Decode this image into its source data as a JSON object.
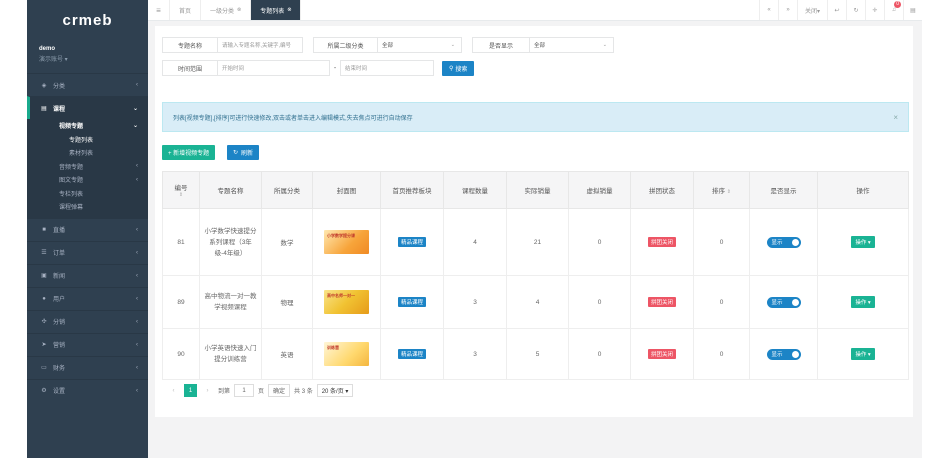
{
  "brand": "crmeb",
  "user": {
    "name": "demo",
    "role": "演示账号 ▾"
  },
  "sidebar": {
    "items_top": [
      {
        "label": "分类",
        "icon": "tag-icon"
      }
    ],
    "course": {
      "label": "课程",
      "icon": "book-icon"
    },
    "course_sub": [
      {
        "label": "视频专题",
        "level": 1,
        "open": true
      },
      {
        "label": "专题列表",
        "level": 2,
        "current": true
      },
      {
        "label": "素材列表",
        "level": 2
      },
      {
        "label": "音频专题",
        "level": 1
      },
      {
        "label": "图文专题",
        "level": 1
      },
      {
        "label": "专栏列表",
        "level": 1
      },
      {
        "label": "课程弹幕",
        "level": 1
      }
    ],
    "items_bottom": [
      {
        "label": "直播",
        "icon": "video-icon"
      },
      {
        "label": "订单",
        "icon": "list-icon"
      },
      {
        "label": "新闻",
        "icon": "news-icon"
      },
      {
        "label": "用户",
        "icon": "user-icon"
      },
      {
        "label": "分销",
        "icon": "share-icon"
      },
      {
        "label": "营销",
        "icon": "send-icon"
      },
      {
        "label": "财务",
        "icon": "money-icon"
      },
      {
        "label": "设置",
        "icon": "gear-icon"
      }
    ]
  },
  "topbar": {
    "tabs": [
      {
        "label": "首页"
      },
      {
        "label": "一级分类"
      },
      {
        "label": "专题列表",
        "active": true
      }
    ],
    "close_label": "关闭▾",
    "bell_count": "0"
  },
  "filters": {
    "title_label": "专题名称",
    "title_placeholder": "请输入专题名称,关键字,编号",
    "category_label": "所属二级分类",
    "category_value": "全部",
    "show_label": "是否显示",
    "show_value": "全部",
    "time_label": "时间范围",
    "start_placeholder": "开始时间",
    "sep": "-",
    "end_placeholder": "结束时间",
    "search_label": "搜索"
  },
  "alert": "列表[视频专题],[排序]可进行快速修改,双击或者单击进入编辑模式,失去焦点可进行自动保存",
  "actions": {
    "add_label": "+ 新增视频专题",
    "refresh_label": "刷新"
  },
  "table": {
    "headers": [
      "编号",
      "专题名称",
      "所属分类",
      "封面图",
      "首页推荐板块",
      "课程数量",
      "实际销量",
      "虚拟销量",
      "拼团状态",
      "排序",
      "是否显示",
      "操作"
    ],
    "rows": [
      {
        "id": "81",
        "name": "小学数学快速提分系列课程（3年级-4年级）",
        "category": "数学",
        "cover_text": "小学数学提分课",
        "recommend": "精品课程",
        "courses": "4",
        "sales": "21",
        "virtual": "0",
        "group": "拼团关闭",
        "sort": "0",
        "show": "显示",
        "op": "操作 ▾"
      },
      {
        "id": "89",
        "name": "高中物流一对一教学视频课程",
        "category": "物理",
        "cover_text": "高中名师一对一",
        "recommend": "精品课程",
        "courses": "3",
        "sales": "4",
        "virtual": "0",
        "group": "拼团关闭",
        "sort": "0",
        "show": "显示",
        "op": "操作 ▾"
      },
      {
        "id": "90",
        "name": "小学英语快速入门提分训练营",
        "category": "英语",
        "cover_text": "训练营",
        "recommend": "精品课程",
        "courses": "3",
        "sales": "5",
        "virtual": "0",
        "group": "拼团关闭",
        "sort": "0",
        "show": "显示",
        "op": "操作 ▾"
      }
    ]
  },
  "pager": {
    "page": "1",
    "goto_label": "到第",
    "goto_value": "1",
    "page_unit": "页",
    "confirm": "确定",
    "total": "共 3 条",
    "size": "20 条/页 ▾"
  }
}
